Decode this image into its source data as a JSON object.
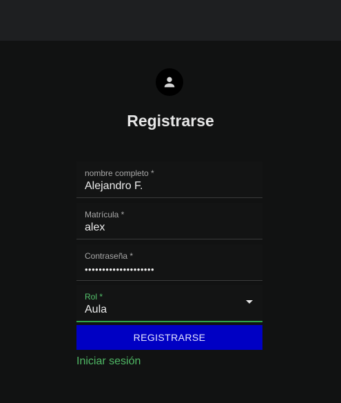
{
  "form": {
    "title": "Registrarse",
    "fields": [
      {
        "label": "nombre completo *",
        "value": "Alejandro F."
      },
      {
        "label": "Matrícula *",
        "value": "alex"
      },
      {
        "label": "Contraseña *",
        "value": "••••••••••••••••••••"
      }
    ],
    "role": {
      "label": "Rol *",
      "value": "Aula"
    },
    "submit_label": "REGISTRARSE",
    "login_link": "Iniciar sesión"
  },
  "colors": {
    "background": "#111212",
    "appbar": "#1e1f21",
    "button": "#0000c4",
    "accent_green": "#55c46c"
  },
  "icons": {
    "avatar": "person-icon",
    "select": "caret-down-icon"
  }
}
